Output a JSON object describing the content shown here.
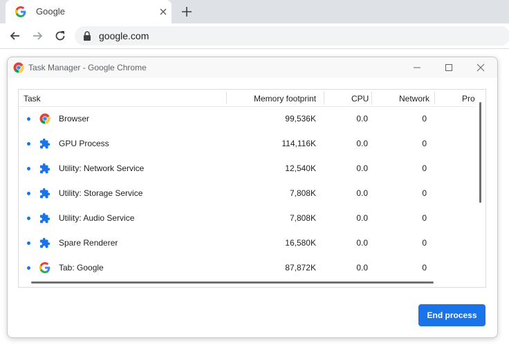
{
  "browser": {
    "tab": {
      "title": "Google",
      "favicon": "google-g-icon"
    },
    "omnibox": {
      "url": "google.com"
    }
  },
  "dialog": {
    "title": "Task Manager - Google Chrome",
    "columns": {
      "task": "Task",
      "memory": "Memory footprint",
      "cpu": "CPU",
      "network": "Network",
      "process": "Pro"
    },
    "rows": [
      {
        "icon": "chrome-icon",
        "task": "Browser",
        "memory": "99,536K",
        "cpu": "0.0",
        "network": "0"
      },
      {
        "icon": "puzzle-piece-icon",
        "task": "GPU Process",
        "memory": "114,116K",
        "cpu": "0.0",
        "network": "0"
      },
      {
        "icon": "puzzle-piece-icon",
        "task": "Utility: Network Service",
        "memory": "12,540K",
        "cpu": "0.0",
        "network": "0"
      },
      {
        "icon": "puzzle-piece-icon",
        "task": "Utility: Storage Service",
        "memory": "7,808K",
        "cpu": "0.0",
        "network": "0"
      },
      {
        "icon": "puzzle-piece-icon",
        "task": "Utility: Audio Service",
        "memory": "7,808K",
        "cpu": "0.0",
        "network": "0"
      },
      {
        "icon": "puzzle-piece-icon",
        "task": "Spare Renderer",
        "memory": "16,580K",
        "cpu": "0.0",
        "network": "0"
      },
      {
        "icon": "google-g-icon",
        "task": "Tab: Google",
        "memory": "87,872K",
        "cpu": "0.0",
        "network": "0"
      }
    ],
    "end_process_label": "End process"
  },
  "colors": {
    "accent": "#1a73e8",
    "tabstrip": "#dee1e6",
    "omnibox": "#f1f3f4"
  }
}
